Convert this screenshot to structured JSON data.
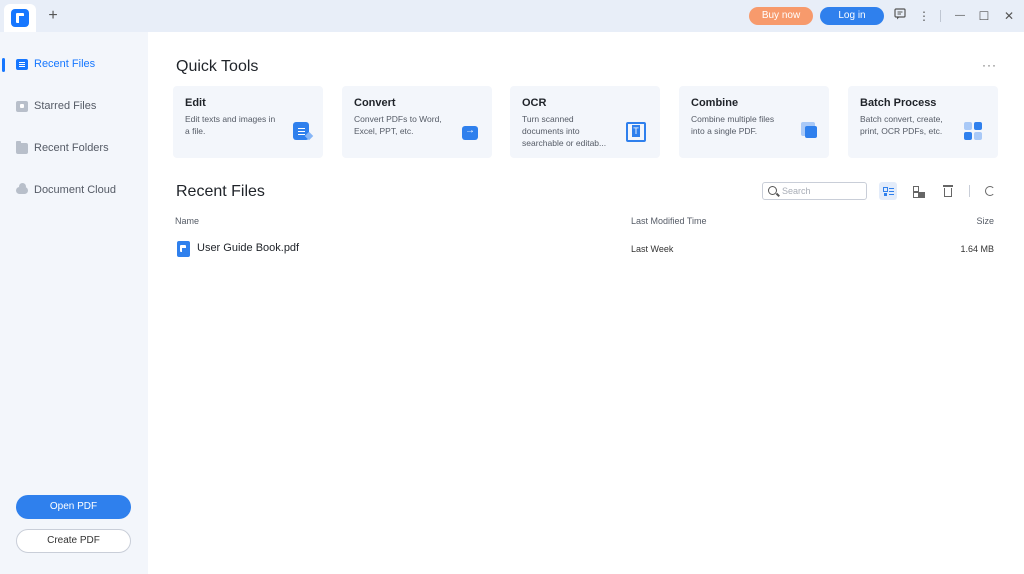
{
  "titlebar": {
    "new_tab_symbol": "+",
    "buy_now_label": "Buy now",
    "login_label": "Log in",
    "feedback_icon": "chat-icon",
    "more_icon": "⋮",
    "minimize_symbol": "—",
    "maximize_symbol": "☐",
    "close_symbol": "✕"
  },
  "sidebar": {
    "items": [
      {
        "label": "Recent Files",
        "icon": "recent-files-icon",
        "active": true
      },
      {
        "label": "Starred Files",
        "icon": "star-icon",
        "active": false
      },
      {
        "label": "Recent Folders",
        "icon": "folder-icon",
        "active": false
      },
      {
        "label": "Document Cloud",
        "icon": "cloud-icon",
        "active": false
      }
    ],
    "open_pdf_label": "Open PDF",
    "create_pdf_label": "Create PDF"
  },
  "quick_tools": {
    "title": "Quick Tools",
    "more_symbol": "···",
    "cards": [
      {
        "title": "Edit",
        "description": "Edit texts and images in a file.",
        "icon": "edit-icon"
      },
      {
        "title": "Convert",
        "description": "Convert PDFs to Word, Excel, PPT, etc.",
        "icon": "convert-icon"
      },
      {
        "title": "OCR",
        "description": "Turn scanned documents into searchable or editab...",
        "icon": "ocr-icon"
      },
      {
        "title": "Combine",
        "description": "Combine multiple files into a single PDF.",
        "icon": "combine-icon"
      },
      {
        "title": "Batch Process",
        "description": "Batch convert, create, print, OCR PDFs, etc.",
        "icon": "batch-icon"
      }
    ]
  },
  "recent_files": {
    "title": "Recent Files",
    "search_placeholder": "Search",
    "columns": {
      "name": "Name",
      "modified": "Last Modified Time",
      "size": "Size"
    },
    "rows": [
      {
        "name": "User Guide Book.pdf",
        "modified": "Last Week",
        "size": "1.64 MB"
      }
    ]
  },
  "colors": {
    "accent": "#2f80ed",
    "buy_now": "#f79a6c",
    "titlebar_bg": "#e8eef8",
    "sidebar_bg": "#f3f6fb"
  }
}
